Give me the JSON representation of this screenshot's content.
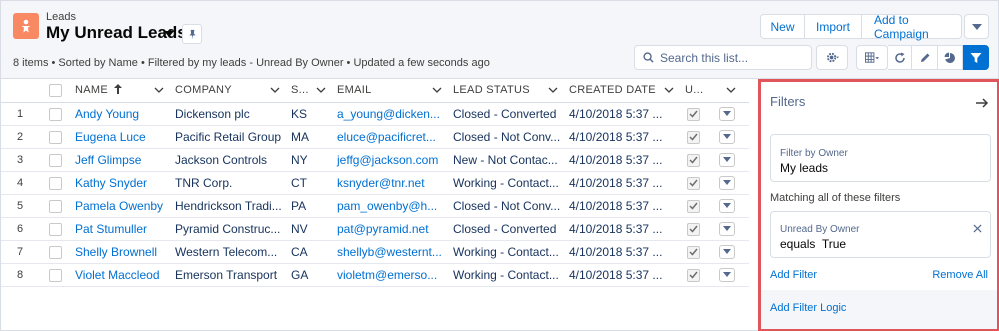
{
  "header": {
    "object_label": "Leads",
    "list_title": "My Unread Leads",
    "subtitle": "8 items • Sorted by Name • Filtered by my leads - Unread By Owner • Updated a few seconds ago",
    "buttons": {
      "new": "New",
      "import": "Import",
      "add_to_campaign": "Add to Campaign"
    },
    "search_placeholder": "Search this list...",
    "icons": {
      "object": "lead-icon",
      "title_dropdown": "chevron-down-icon",
      "pin": "pin-icon",
      "more": "chevron-down-icon",
      "search": "search-icon",
      "settings": "gear-icon",
      "display": "table-icon",
      "refresh": "refresh-icon",
      "edit": "pencil-icon",
      "chart": "chart-icon",
      "filter": "filter-icon"
    }
  },
  "table": {
    "columns": [
      "NAME",
      "COMPANY",
      "S...",
      "EMAIL",
      "LEAD STATUS",
      "CREATED DATE",
      "U..."
    ],
    "sort_icon": "arrow-up-icon",
    "rows": [
      {
        "num": "1",
        "name": "Andy Young",
        "company": "Dickenson plc",
        "state": "KS",
        "email": "a_young@dicken...",
        "status": "Closed - Converted",
        "created": "4/10/2018 5:37 ..."
      },
      {
        "num": "2",
        "name": "Eugena Luce",
        "company": "Pacific Retail Group",
        "state": "MA",
        "email": "eluce@pacificret...",
        "status": "Closed - Not Conv...",
        "created": "4/10/2018 5:37 ..."
      },
      {
        "num": "3",
        "name": "Jeff Glimpse",
        "company": "Jackson Controls",
        "state": "NY",
        "email": "jeffg@jackson.com",
        "status": "New - Not Contac...",
        "created": "4/10/2018 5:37 ..."
      },
      {
        "num": "4",
        "name": "Kathy Snyder",
        "company": "TNR Corp.",
        "state": "CT",
        "email": "ksnyder@tnr.net",
        "status": "Working - Contact...",
        "created": "4/10/2018 5:37 ..."
      },
      {
        "num": "5",
        "name": "Pamela Owenby",
        "company": "Hendrickson Tradi...",
        "state": "PA",
        "email": "pam_owenby@h...",
        "status": "Closed - Not Conv...",
        "created": "4/10/2018 5:37 ..."
      },
      {
        "num": "6",
        "name": "Pat Stumuller",
        "company": "Pyramid Construc...",
        "state": "NV",
        "email": "pat@pyramid.net",
        "status": "Closed - Converted",
        "created": "4/10/2018 5:37 ..."
      },
      {
        "num": "7",
        "name": "Shelly Brownell",
        "company": "Western Telecom...",
        "state": "CA",
        "email": "shellyb@westernt...",
        "status": "Working - Contact...",
        "created": "4/10/2018 5:37 ..."
      },
      {
        "num": "8",
        "name": "Violet Maccleod",
        "company": "Emerson Transport",
        "state": "GA",
        "email": "violetm@emerso...",
        "status": "Working - Contact...",
        "created": "4/10/2018 5:37 ..."
      }
    ]
  },
  "filters": {
    "title": "Filters",
    "owner_label": "Filter by Owner",
    "owner_value": "My leads",
    "matching_label": "Matching all of these filters",
    "filter_field": "Unread By Owner",
    "filter_op": "equals",
    "filter_value": "True",
    "add_filter": "Add Filter",
    "remove_all": "Remove All",
    "add_logic": "Add Filter Logic",
    "close_icon": "arrow-right-icon",
    "remove_icon": "close-icon"
  },
  "colors": {
    "link": "#0070d2",
    "header_bg": "#f4f6f9",
    "highlight_border": "#e0555a",
    "object_icon": "#f88962",
    "filter_active": "#0070d2"
  }
}
